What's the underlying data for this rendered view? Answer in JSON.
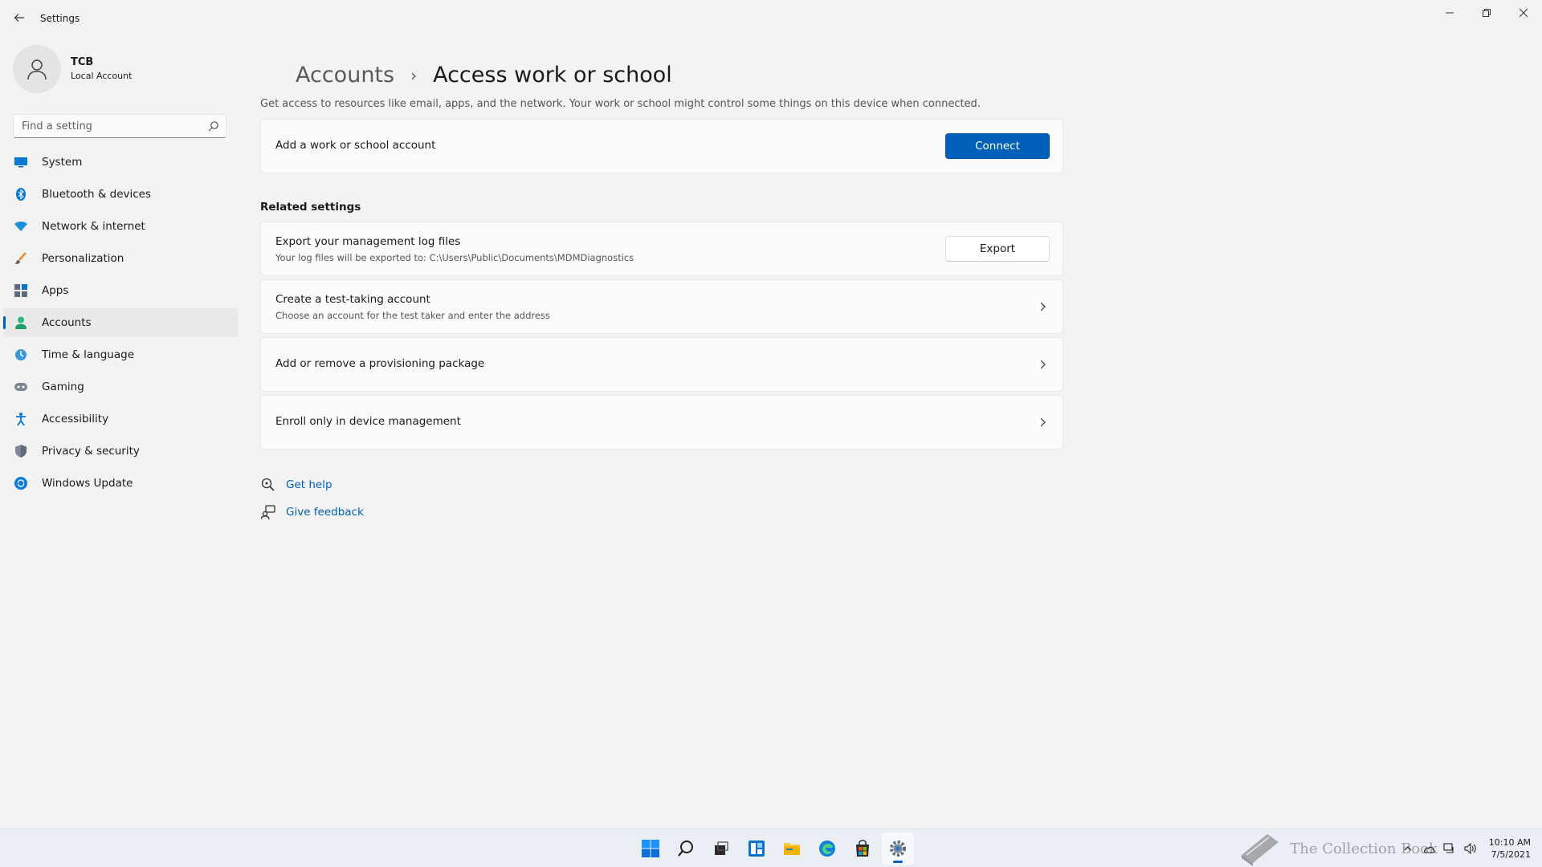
{
  "window": {
    "title": "Settings"
  },
  "profile": {
    "name": "TCB",
    "subtitle": "Local Account"
  },
  "search": {
    "placeholder": "Find a setting"
  },
  "nav": {
    "items": [
      {
        "label": "System",
        "icon": "monitor-icon"
      },
      {
        "label": "Bluetooth & devices",
        "icon": "bluetooth-icon"
      },
      {
        "label": "Network & internet",
        "icon": "wifi-icon"
      },
      {
        "label": "Personalization",
        "icon": "brush-icon"
      },
      {
        "label": "Apps",
        "icon": "apps-icon"
      },
      {
        "label": "Accounts",
        "icon": "person-icon",
        "active": true
      },
      {
        "label": "Time & language",
        "icon": "globe-clock-icon"
      },
      {
        "label": "Gaming",
        "icon": "gamepad-icon"
      },
      {
        "label": "Accessibility",
        "icon": "accessibility-icon"
      },
      {
        "label": "Privacy & security",
        "icon": "shield-icon"
      },
      {
        "label": "Windows Update",
        "icon": "update-icon"
      }
    ]
  },
  "breadcrumb": {
    "parent": "Accounts",
    "separator": "›",
    "current": "Access work or school"
  },
  "description": "Get access to resources like email, apps, and the network. Your work or school might control some things on this device when connected.",
  "connect_card": {
    "title": "Add a work or school account",
    "button": "Connect"
  },
  "related": {
    "heading": "Related settings",
    "export": {
      "title": "Export your management log files",
      "subtitle": "Your log files will be exported to: C:\\Users\\Public\\Documents\\MDMDiagnostics",
      "button": "Export"
    },
    "test_account": {
      "title": "Create a test-taking account",
      "subtitle": "Choose an account for the test taker and enter the address"
    },
    "provisioning": {
      "title": "Add or remove a provisioning package"
    },
    "enroll": {
      "title": "Enroll only in device management"
    }
  },
  "links": {
    "help": "Get help",
    "feedback": "Give feedback"
  },
  "taskbar": {
    "time": "10:10 AM",
    "date": "7/5/2021",
    "watermark": "The Collection Book"
  },
  "colors": {
    "accent": "#005fb8",
    "background": "#f3f3f3",
    "card": "#fbfbfb"
  }
}
